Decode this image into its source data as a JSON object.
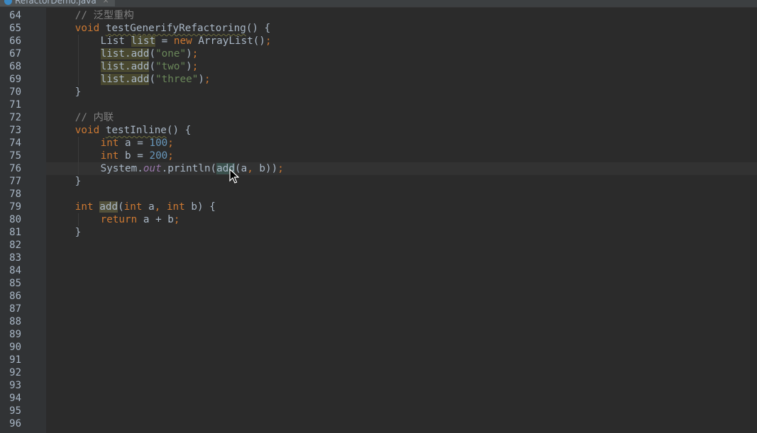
{
  "tab": {
    "filename": "RefactorDemo.java",
    "close_glyph": "×"
  },
  "editor": {
    "current_line": 76,
    "lines": [
      {
        "num": "64",
        "indent": 4,
        "tokens": [
          {
            "t": "// 泛型重构",
            "c": "cmt"
          }
        ]
      },
      {
        "num": "65",
        "indent": 4,
        "tokens": [
          {
            "t": "void",
            "c": "kw"
          },
          {
            "t": " "
          },
          {
            "t": "testGenerifyRefactoring",
            "c": "meth"
          },
          {
            "t": "() {"
          }
        ]
      },
      {
        "num": "66",
        "indent": 8,
        "tokens": [
          {
            "t": "List "
          },
          {
            "t": "list",
            "c": "hl"
          },
          {
            "t": " = "
          },
          {
            "t": "new",
            "c": "kw"
          },
          {
            "t": " ArrayList()"
          },
          {
            "t": ";",
            "c": "kw"
          }
        ]
      },
      {
        "num": "67",
        "indent": 8,
        "tokens": [
          {
            "t": "list.add",
            "c": "hl"
          },
          {
            "t": "("
          },
          {
            "t": "\"one\"",
            "c": "str"
          },
          {
            "t": ")"
          },
          {
            "t": ";",
            "c": "kw"
          }
        ]
      },
      {
        "num": "68",
        "indent": 8,
        "tokens": [
          {
            "t": "list.add",
            "c": "hl"
          },
          {
            "t": "("
          },
          {
            "t": "\"two\"",
            "c": "str"
          },
          {
            "t": ")"
          },
          {
            "t": ";",
            "c": "kw"
          }
        ]
      },
      {
        "num": "69",
        "indent": 8,
        "tokens": [
          {
            "t": "list.add",
            "c": "hl"
          },
          {
            "t": "("
          },
          {
            "t": "\"three\"",
            "c": "str"
          },
          {
            "t": ")"
          },
          {
            "t": ";",
            "c": "kw"
          }
        ]
      },
      {
        "num": "70",
        "indent": 4,
        "tokens": [
          {
            "t": "}"
          }
        ]
      },
      {
        "num": "71",
        "indent": 0,
        "tokens": []
      },
      {
        "num": "72",
        "indent": 4,
        "tokens": [
          {
            "t": "// 内联",
            "c": "cmt"
          }
        ]
      },
      {
        "num": "73",
        "indent": 4,
        "tokens": [
          {
            "t": "void",
            "c": "kw"
          },
          {
            "t": " "
          },
          {
            "t": "testInline",
            "c": "meth"
          },
          {
            "t": "() {"
          }
        ]
      },
      {
        "num": "74",
        "indent": 8,
        "tokens": [
          {
            "t": "int",
            "c": "kw"
          },
          {
            "t": " a = "
          },
          {
            "t": "100",
            "c": "num"
          },
          {
            "t": ";",
            "c": "kw"
          }
        ]
      },
      {
        "num": "75",
        "indent": 8,
        "tokens": [
          {
            "t": "int",
            "c": "kw"
          },
          {
            "t": " b = "
          },
          {
            "t": "200",
            "c": "num"
          },
          {
            "t": ";",
            "c": "kw"
          }
        ]
      },
      {
        "num": "76",
        "indent": 8,
        "tokens": [
          {
            "t": "System."
          },
          {
            "t": "out",
            "c": "field"
          },
          {
            "t": ".println("
          },
          {
            "t": "add",
            "c": "hl2"
          },
          {
            "t": "(a"
          },
          {
            "t": ",",
            "c": "kw"
          },
          {
            "t": " b))"
          },
          {
            "t": ";",
            "c": "kw"
          }
        ]
      },
      {
        "num": "77",
        "indent": 4,
        "tokens": [
          {
            "t": "}"
          }
        ]
      },
      {
        "num": "78",
        "indent": 0,
        "tokens": []
      },
      {
        "num": "79",
        "indent": 4,
        "tokens": [
          {
            "t": "int",
            "c": "kw"
          },
          {
            "t": " "
          },
          {
            "t": "add",
            "c": "sel"
          },
          {
            "t": "("
          },
          {
            "t": "int",
            "c": "kw"
          },
          {
            "t": " a"
          },
          {
            "t": ",",
            "c": "kw"
          },
          {
            "t": " "
          },
          {
            "t": "int",
            "c": "kw"
          },
          {
            "t": " b) {"
          }
        ]
      },
      {
        "num": "80",
        "indent": 8,
        "tokens": [
          {
            "t": "return",
            "c": "kw"
          },
          {
            "t": " a + b"
          },
          {
            "t": ";",
            "c": "kw"
          }
        ]
      },
      {
        "num": "81",
        "indent": 4,
        "tokens": [
          {
            "t": "}"
          }
        ]
      },
      {
        "num": "82",
        "indent": 0,
        "tokens": []
      },
      {
        "num": "83",
        "indent": 0,
        "tokens": []
      },
      {
        "num": "84",
        "indent": 0,
        "tokens": []
      },
      {
        "num": "85",
        "indent": 0,
        "tokens": []
      },
      {
        "num": "86",
        "indent": 0,
        "tokens": []
      },
      {
        "num": "87",
        "indent": 0,
        "tokens": []
      },
      {
        "num": "88",
        "indent": 0,
        "tokens": []
      },
      {
        "num": "89",
        "indent": 0,
        "tokens": []
      },
      {
        "num": "90",
        "indent": 0,
        "tokens": []
      },
      {
        "num": "91",
        "indent": 0,
        "tokens": []
      },
      {
        "num": "92",
        "indent": 0,
        "tokens": []
      },
      {
        "num": "93",
        "indent": 0,
        "tokens": []
      },
      {
        "num": "94",
        "indent": 0,
        "tokens": []
      },
      {
        "num": "95",
        "indent": 0,
        "tokens": []
      },
      {
        "num": "96",
        "indent": 0,
        "tokens": []
      }
    ]
  },
  "icons": {
    "file": "java-file-icon",
    "cursor": "mouse-pointer-icon"
  },
  "colors": {
    "background": "#2b2b2b",
    "gutter": "#313335",
    "text": "#a9b7c6",
    "keyword": "#cc7832",
    "string": "#6a8759",
    "number": "#6897bb",
    "comment": "#808080",
    "field": "#9876aa"
  }
}
